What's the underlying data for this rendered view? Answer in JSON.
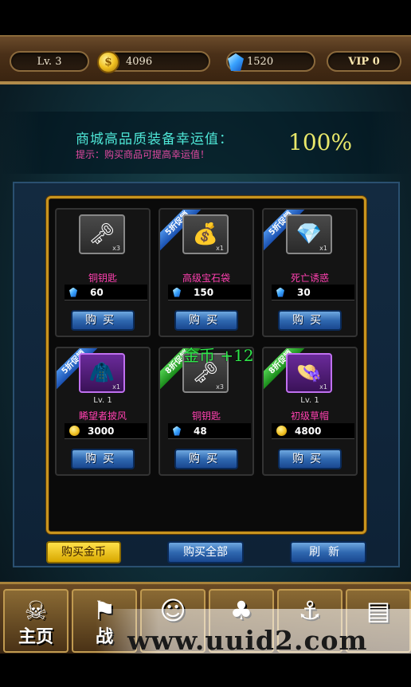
{
  "resources": {
    "level": "Lv. 3",
    "gold": "4096",
    "gems": "1520",
    "vip": "VIP 0"
  },
  "luck": {
    "title": "商城高品质装备幸运值：",
    "hint": "提示：购买商品可提高幸运值！",
    "value": "100%"
  },
  "items": [
    {
      "name": "铜钥匙",
      "qty": "x3",
      "level": "",
      "price": "60",
      "currency": "gem",
      "icon": "key-icon",
      "promo": ""
    },
    {
      "name": "高级宝石袋",
      "qty": "x1",
      "level": "",
      "price": "150",
      "currency": "gem",
      "icon": "gem-bag-icon",
      "promo": "5折促销"
    },
    {
      "name": "死亡诱惑",
      "qty": "x1",
      "level": "",
      "price": "30",
      "currency": "gem",
      "icon": "treasure-icon",
      "promo": "5折促销"
    },
    {
      "name": "睎望者披风",
      "qty": "x1",
      "level": "Lv. 1",
      "price": "3000",
      "currency": "gold",
      "icon": "cloak-icon",
      "promo": "5折促销"
    },
    {
      "name": "铜钥匙",
      "qty": "x3",
      "level": "",
      "price": "48",
      "currency": "gem",
      "icon": "key-icon",
      "promo": "8折促销"
    },
    {
      "name": "初级草帽",
      "qty": "x1",
      "level": "Lv. 1",
      "price": "4800",
      "currency": "gold",
      "icon": "straw-hat-icon",
      "promo": "8折促销"
    }
  ],
  "buy_label": "购买",
  "float_text": "金币 +12",
  "actions": {
    "buy_gold": "购买金币",
    "buy_all": "购买全部",
    "refresh": "刷新"
  },
  "nav": {
    "home": "主页",
    "battle": "战"
  },
  "watermark": "www.uuid2.com"
}
